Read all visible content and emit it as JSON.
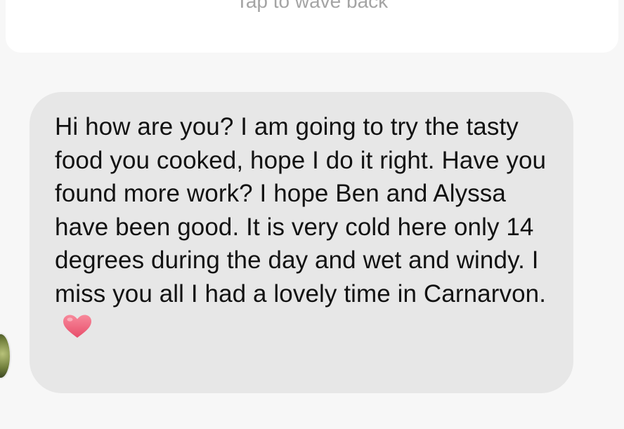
{
  "wave": {
    "label": "Tap to wave back"
  },
  "message": {
    "text": "Hi how are you? I am going to try the tasty food you cooked, hope I do it right. Have you found more work? I hope Ben and Alyssa have been good. It is very cold here only 14 degrees during the day and wet and windy. I miss you all I had a lovely time in Carnarvon.",
    "emoji": "heart-icon",
    "bubble_color": "#e7e7e7",
    "heart_color": "#f0607a"
  },
  "avatar": {
    "icon": "avatar-photo"
  }
}
